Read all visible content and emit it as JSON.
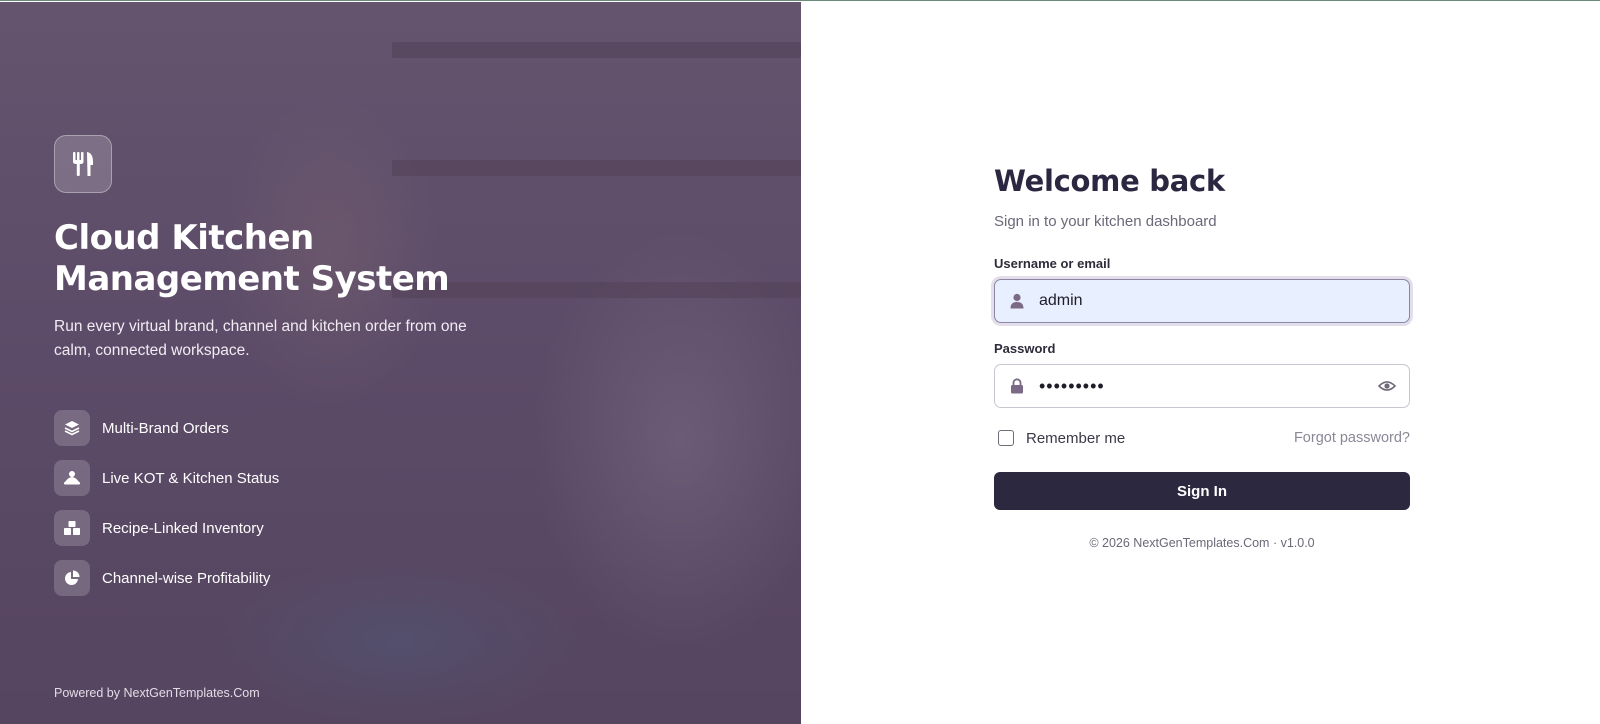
{
  "hero": {
    "title": "Cloud Kitchen Management System",
    "subtitle": "Run every virtual brand, channel and kitchen order from one calm, connected workspace.",
    "logo_icon": "utensils-icon",
    "features": [
      {
        "label": "Multi-Brand Orders",
        "icon": "layers-icon"
      },
      {
        "label": "Live KOT & Kitchen Status",
        "icon": "kitchen-status-icon"
      },
      {
        "label": "Recipe-Linked Inventory",
        "icon": "inventory-boxes-icon"
      },
      {
        "label": "Channel-wise Profitability",
        "icon": "pie-chart-icon"
      }
    ],
    "powered_by": "Powered by NextGenTemplates.Com"
  },
  "login": {
    "title": "Welcome back",
    "subtitle": "Sign in to your kitchen dashboard",
    "username_label": "Username or email",
    "username_value": "admin",
    "username_icon": "user-icon",
    "password_label": "Password",
    "password_value": "•••••••••",
    "password_icon": "lock-icon",
    "reveal_icon": "eye-icon",
    "remember_label": "Remember me",
    "remember_checked": false,
    "forgot_label": "Forgot password?",
    "submit_label": "Sign In",
    "copyright": "© 2026 NextGenTemplates.Com · v1.0.0"
  },
  "colors": {
    "primary": "#2c2840",
    "accent": "#8b6b9a",
    "hero_overlay": "#5c4a6c"
  }
}
